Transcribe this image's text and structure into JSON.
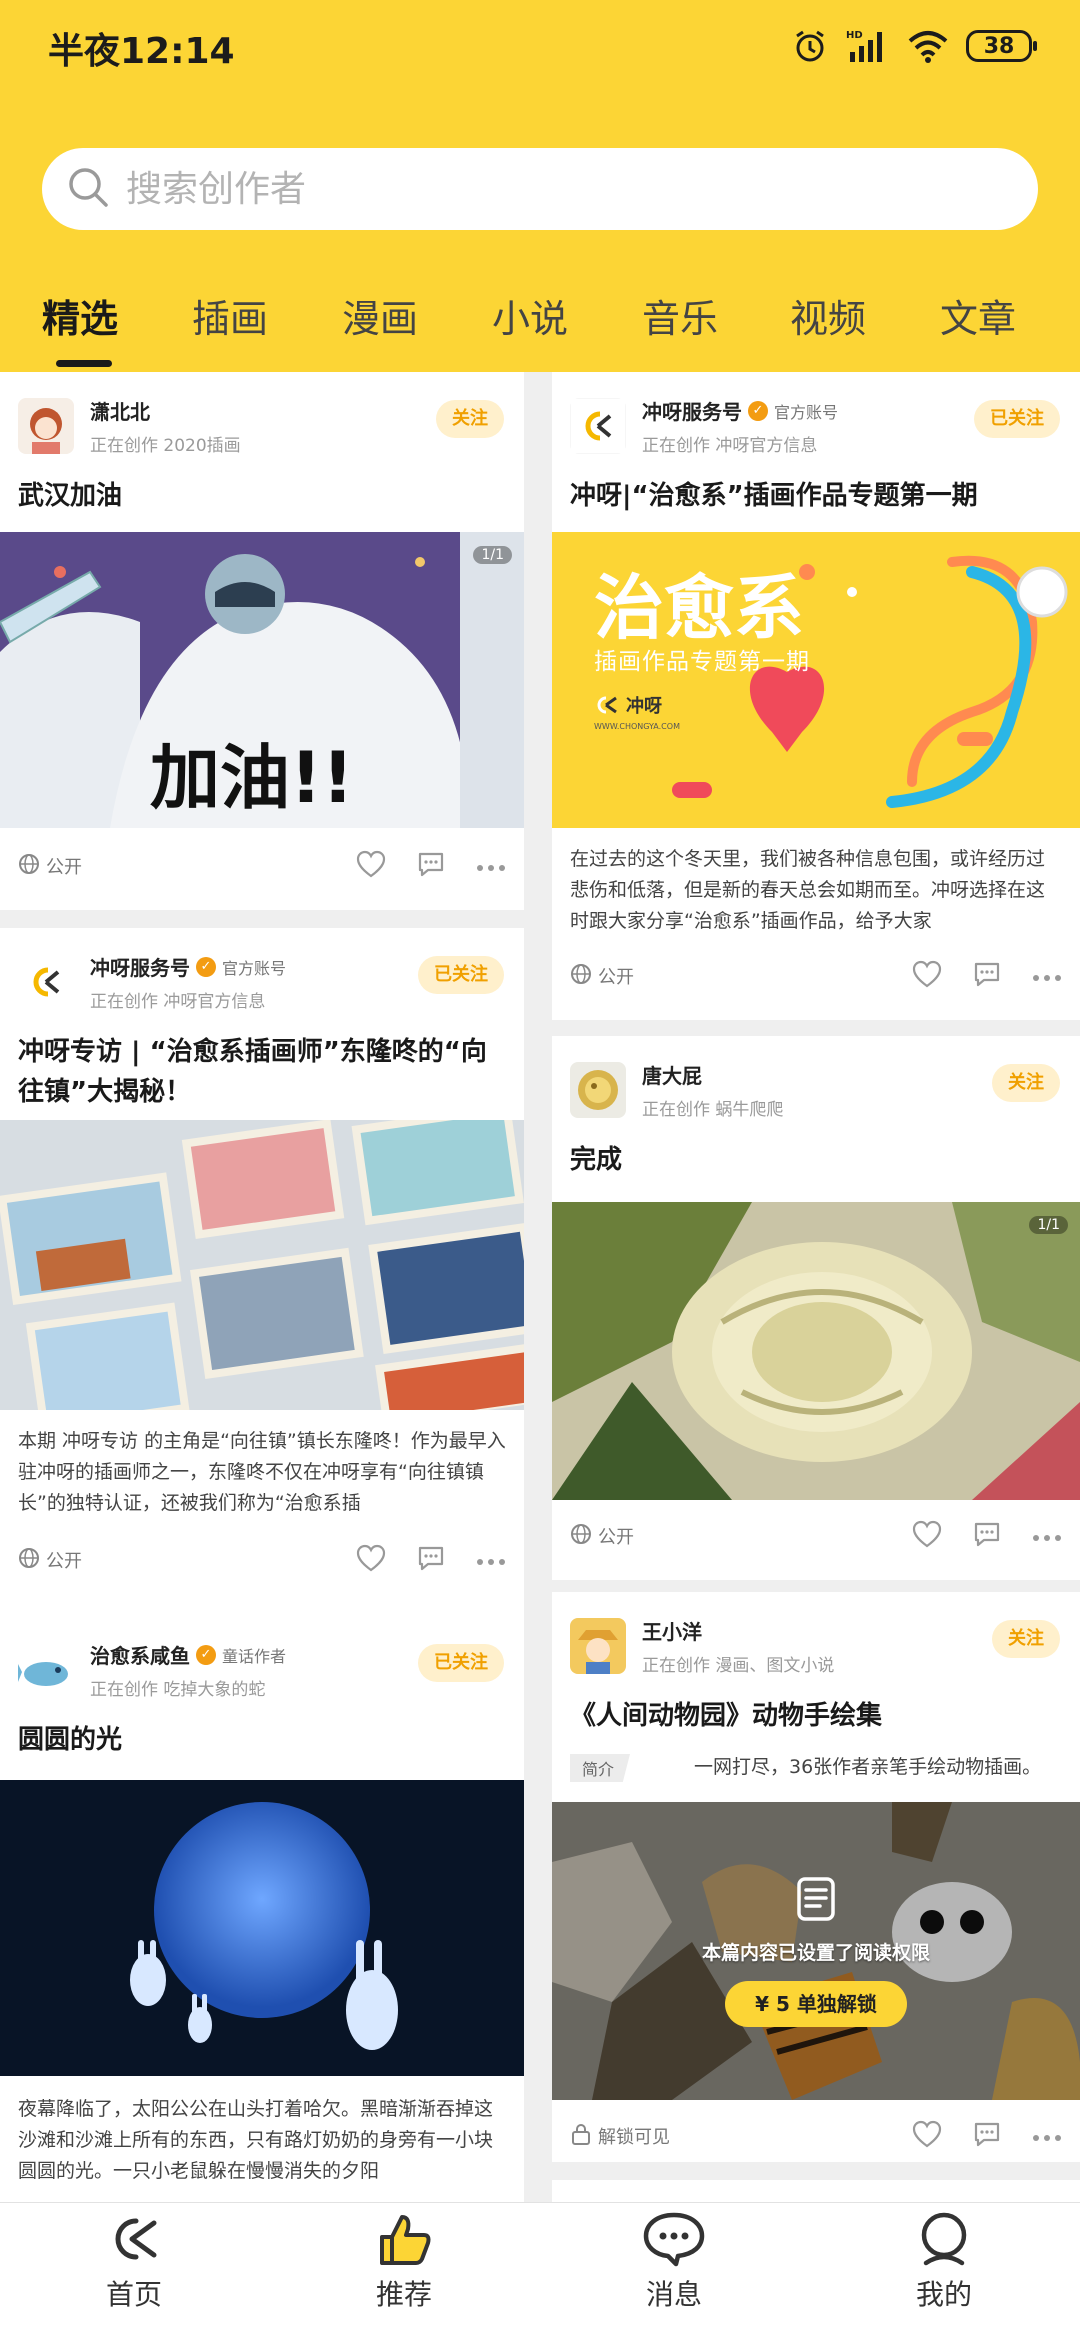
{
  "status": {
    "time": "半夜12:14",
    "battery": "38",
    "network_label": "HD"
  },
  "search": {
    "placeholder": "搜索创作者"
  },
  "tabs": [
    {
      "label": "精选",
      "active": true
    },
    {
      "label": "插画"
    },
    {
      "label": "漫画"
    },
    {
      "label": "小说"
    },
    {
      "label": "音乐"
    },
    {
      "label": "视频"
    },
    {
      "label": "文章"
    }
  ],
  "cards": {
    "c1": {
      "author": "潇北北",
      "sub": "正在创作 2020插画",
      "follow": "关注",
      "title": "武汉加油",
      "img_count": "1/1",
      "visibility": "公开"
    },
    "c2": {
      "author": "冲呀服务号",
      "badge": "官方账号",
      "sub": "正在创作 冲呀官方信息",
      "follow": "已关注",
      "title": "冲呀|“治愈系”插画作品专题第一期",
      "banner_title": "治愈系",
      "banner_sub": "插画作品专题第一期",
      "banner_brand": "冲呀",
      "banner_url": "WWW.CHONGYA.COM",
      "excerpt": "在过去的这个冬天里，我们被各种信息包围，或许经历过悲伤和低落，但是新的春天总会如期而至。冲呀选择在这时跟大家分享“治愈系”插画作品，给予大家",
      "visibility": "公开"
    },
    "c3": {
      "author": "冲呀服务号",
      "badge": "官方账号",
      "sub": "正在创作 冲呀官方信息",
      "follow": "已关注",
      "title": "冲呀专访 | “治愈系插画师”东隆咚的“向往镇”大揭秘！",
      "excerpt": "本期 冲呀专访 的主角是“向往镇”镇长东隆咚！作为最早入驻冲呀的插画师之一，东隆咚不仅在冲呀享有“向往镇镇长”的独特认证，还被我们称为“治愈系插",
      "visibility": "公开"
    },
    "c4": {
      "author": "唐大屁",
      "sub": "正在创作 蜗牛爬爬",
      "follow": "关注",
      "title": "完成",
      "img_count": "1/1",
      "visibility": "公开"
    },
    "c5": {
      "author": "治愈系咸鱼",
      "badge": "童话作者",
      "sub": "正在创作 吃掉大象的蛇",
      "follow": "已关注",
      "title": "圆圆的光",
      "excerpt": "夜幕降临了，太阳公公在山头打着哈欠。黑暗渐渐吞掉这沙滩和沙滩上所有的东西，只有路灯奶奶的身旁有一小块圆圆的光。一只小老鼠躲在慢慢消失的夕阳"
    },
    "c6": {
      "author": "王小洋",
      "sub": "正在创作 漫画、图文小说",
      "follow": "关注",
      "title": "《人间动物园》动物手绘集",
      "intro_label": "简介",
      "intro": "一网打尽，36张作者亲笔手绘动物插画。",
      "lock_text": "本篇内容已设置了阅读权限",
      "unlock_button": "¥ 5 单独解锁",
      "visibility": "解锁可见"
    }
  },
  "nav": [
    {
      "label": "首页",
      "icon": "home-icon"
    },
    {
      "label": "推荐",
      "icon": "thumbs-up-icon"
    },
    {
      "label": "消息",
      "icon": "message-icon"
    },
    {
      "label": "我的",
      "icon": "profile-icon"
    }
  ],
  "colors": {
    "brand_yellow": "#fcd535",
    "follow_text": "#f0a000",
    "follow_bg": "#fff0cc"
  }
}
